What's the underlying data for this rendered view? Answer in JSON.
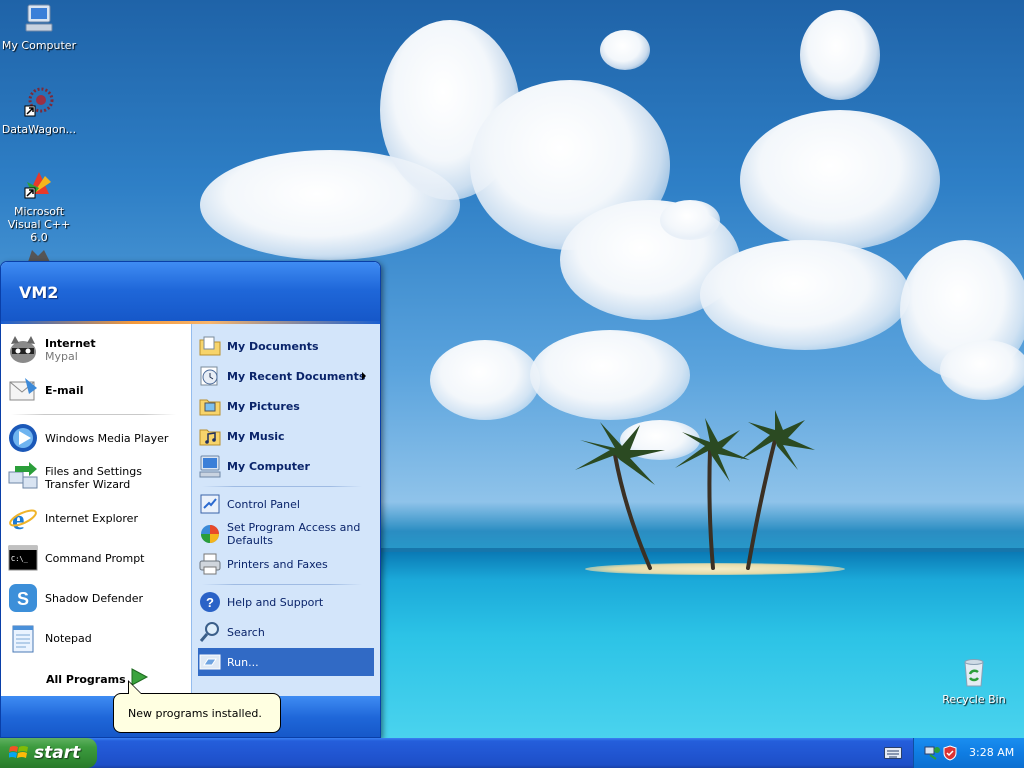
{
  "desktop": {
    "icons": [
      {
        "label": "My Computer"
      },
      {
        "label": "DataWagon..."
      },
      {
        "label": "Microsoft Visual C++ 6.0"
      },
      {
        "label": "Recycle Bin"
      }
    ]
  },
  "start_menu": {
    "user": "VM2",
    "left_items": [
      {
        "label": "Internet",
        "sub": "Mypal"
      },
      {
        "label": "E-mail"
      },
      {
        "label": "Windows Media Player"
      },
      {
        "label": "Files and Settings Transfer Wizard"
      },
      {
        "label": "Internet Explorer"
      },
      {
        "label": "Command Prompt"
      },
      {
        "label": "Shadow Defender"
      },
      {
        "label": "Notepad"
      }
    ],
    "all_programs": "All Programs",
    "right_items": [
      {
        "label": "My Documents"
      },
      {
        "label": "My Recent Documents"
      },
      {
        "label": "My Pictures"
      },
      {
        "label": "My Music"
      },
      {
        "label": "My Computer"
      },
      {
        "label": "Control Panel"
      },
      {
        "label": "Set Program Access and Defaults"
      },
      {
        "label": "Printers and Faxes"
      },
      {
        "label": "Help and Support"
      },
      {
        "label": "Search"
      },
      {
        "label": "Run..."
      }
    ]
  },
  "balloon": {
    "text": "New programs installed."
  },
  "taskbar": {
    "start_label": "start",
    "clock": "3:28 AM"
  },
  "colors": {
    "taskbar_blue": "#245edb",
    "start_green": "#3d9b3f",
    "selection_blue": "#316ac5",
    "menu_right_bg": "#d3e5fa"
  }
}
